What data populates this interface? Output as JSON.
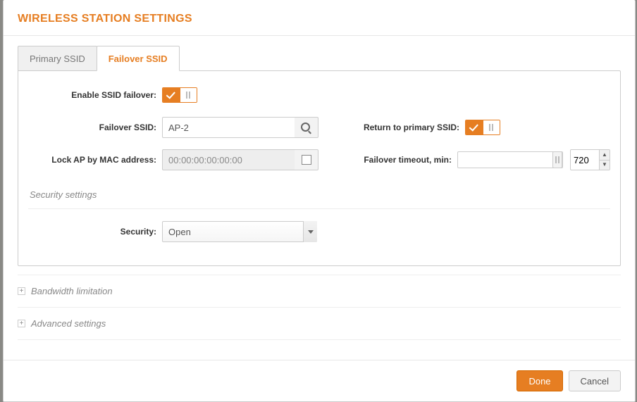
{
  "title": "WIRELESS STATION SETTINGS",
  "tabs": {
    "primary": "Primary SSID",
    "failover": "Failover SSID"
  },
  "form": {
    "enable_label": "Enable SSID failover:",
    "enable_value": "on",
    "ssid_label": "Failover SSID:",
    "ssid_value": "AP-2",
    "lock_label": "Lock AP by MAC address:",
    "lock_value": "00:00:00:00:00:00",
    "lock_checked": false,
    "return_label": "Return to primary SSID:",
    "return_value": "on",
    "timeout_label": "Failover timeout, min:",
    "timeout_value": "720"
  },
  "security": {
    "heading": "Security settings",
    "label": "Security:",
    "value": "Open"
  },
  "accordion": {
    "bandwidth": "Bandwidth limitation",
    "advanced": "Advanced settings"
  },
  "buttons": {
    "done": "Done",
    "cancel": "Cancel"
  }
}
